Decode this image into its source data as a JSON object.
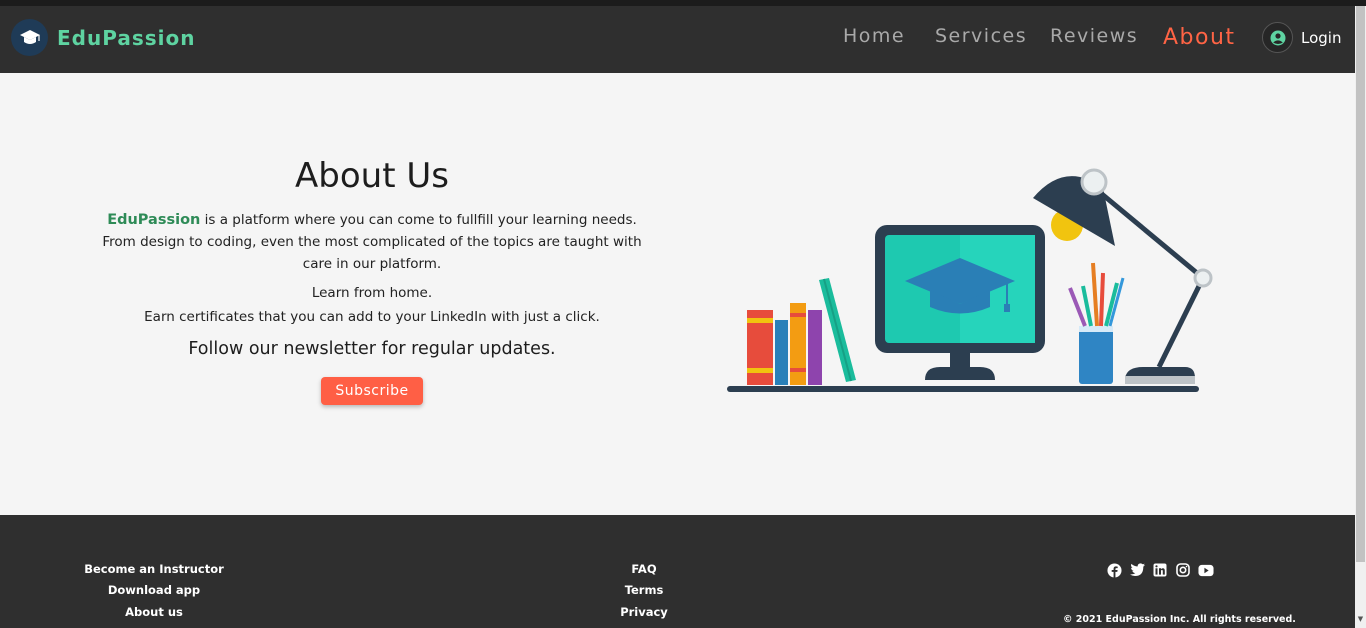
{
  "brand": {
    "name": "EduPassion",
    "logo_icon": "graduation-cap-icon"
  },
  "nav": {
    "items": [
      {
        "label": "Home"
      },
      {
        "label": "Services"
      },
      {
        "label": "Reviews"
      },
      {
        "label": "About",
        "active": true
      }
    ],
    "login": {
      "label": "Login",
      "icon": "user-circle-icon"
    }
  },
  "about": {
    "title": "About Us",
    "brand_inline": "EduPassion",
    "description": " is a platform where you can come to fullfill your learning needs. From design to coding, even the most complicated of the topics are taught with care in our platform.",
    "line1": "Learn from home.",
    "line2": "Earn certificates that you can add to your LinkedIn with just a click.",
    "newsletter": "Follow our newsletter for regular updates.",
    "subscribe_label": "Subscribe"
  },
  "footer": {
    "left_links": [
      "Become an Instructor",
      "Download app",
      "About us"
    ],
    "mid_links": [
      "FAQ",
      "Terms",
      "Privacy"
    ],
    "social_icons": [
      "facebook-icon",
      "twitter-icon",
      "linkedin-icon",
      "instagram-icon",
      "youtube-icon"
    ],
    "copyright": "© 2021 EduPassion Inc. All rights reserved."
  },
  "colors": {
    "nav_bg": "#2f2f2f",
    "brand_text": "#5ed3a1",
    "active_link": "#ff6445",
    "accent_button": "#ff5f45",
    "brand_inline": "#2e8b57",
    "footer_bg": "#2f2f2f"
  }
}
